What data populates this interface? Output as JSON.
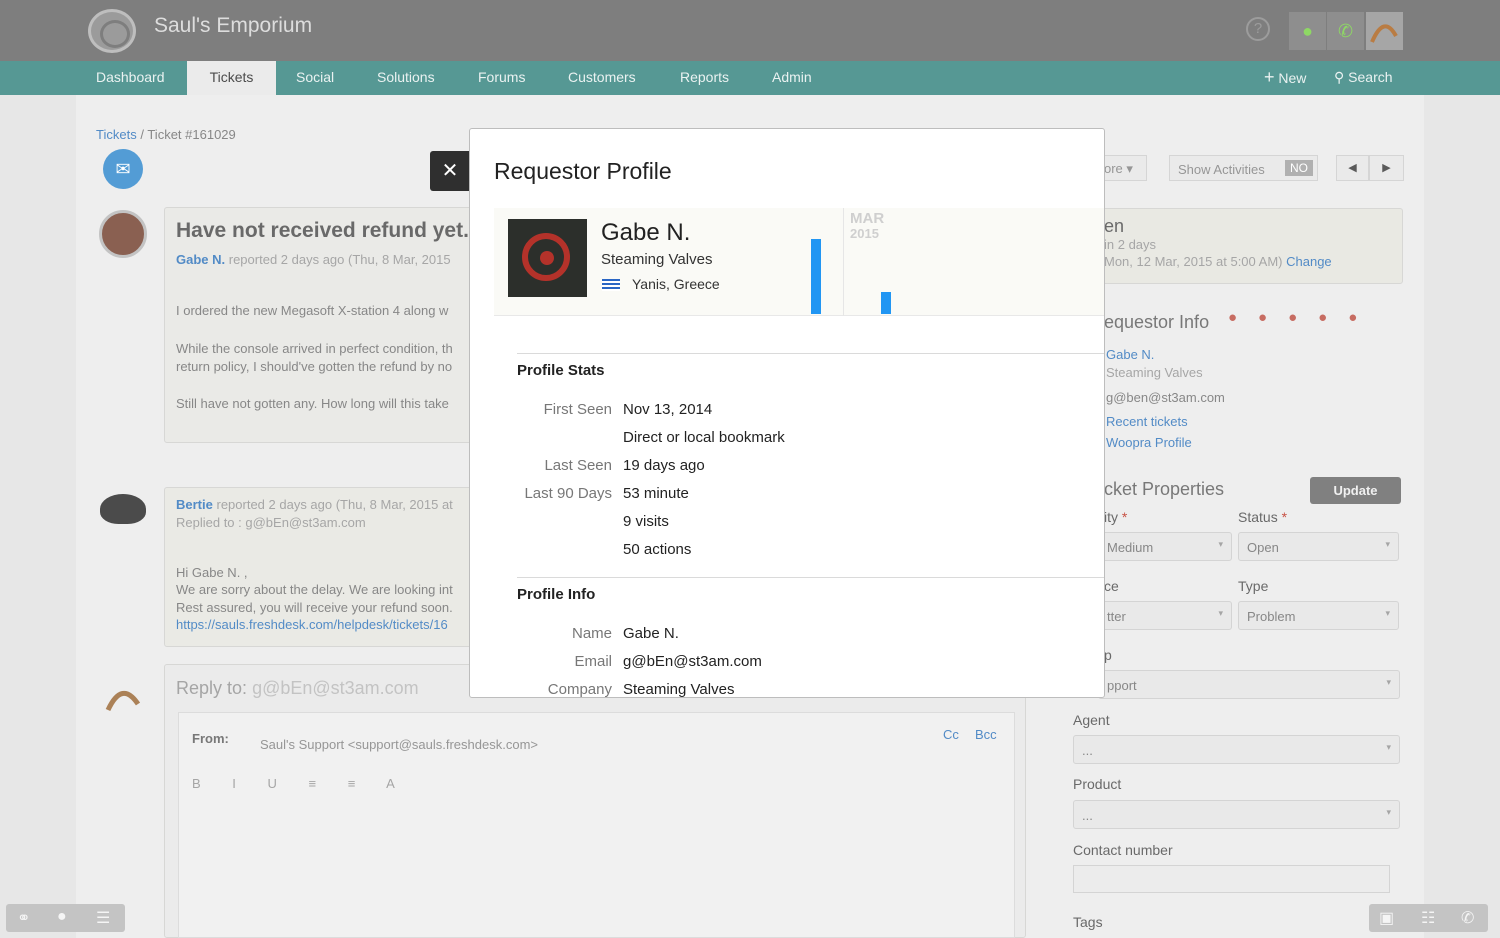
{
  "app": {
    "brand": "Saul's Emporium"
  },
  "nav": {
    "items": [
      "Dashboard",
      "Tickets",
      "Social",
      "Solutions",
      "Forums",
      "Customers",
      "Reports",
      "Admin"
    ],
    "active": "Tickets",
    "new_label": "New",
    "search_label": "Search"
  },
  "breadcrumb": {
    "root": "Tickets",
    "sep": "/",
    "current": "Ticket #161029"
  },
  "ticket": {
    "subject": "Have not received refund yet.",
    "requester": "Gabe N.",
    "reported": "reported 2 days ago (Thu, 8 Mar, 2015",
    "body1": "I ordered the new Megasoft X-station 4 along w",
    "body2a": "While the console arrived in perfect condition, th",
    "body2b": "return policy, I should've gotten the refund by no",
    "body3": "Still have not gotten any. How long will this take"
  },
  "reply": {
    "author": "Bertie",
    "meta": "reported 2 days ago (Thu, 8 Mar, 2015 at",
    "replied_to": "Replied to : g@bEn@st3am.com",
    "l1": "Hi Gabe N. ,",
    "l2": "We are sorry about the delay. We are looking int",
    "l3": "Rest assured, you will receive your refund soon.",
    "link": "https://sauls.freshdesk.com/helpdesk/tickets/16"
  },
  "composer": {
    "reply_to_label": "Reply to:",
    "reply_to_email": "g@bEn@st3am.com",
    "from_label": "From:",
    "from_value": "Saul's Support <support@sauls.freshdesk.com>",
    "cc": "Cc",
    "bcc": "Bcc"
  },
  "toolbar": {
    "more": "ore",
    "show_activities": "Show Activities",
    "toggle": "NO"
  },
  "side": {
    "status_title": "en",
    "due_line1": "in 2 days",
    "due_line2": "Mon, 12 Mar, 2015 at 5:00 AM)",
    "change": "Change",
    "requestor_title": "equestor Info",
    "req_name": "Gabe N.",
    "req_company": "Steaming Valves",
    "req_email": "g@ben@st3am.com",
    "recent_tickets": "Recent tickets",
    "woopra_profile": "Woopra Profile",
    "props_title": "cket Properties",
    "update": "Update",
    "priority_label": "ity",
    "status_label": "Status",
    "priority_value": "Medium",
    "status_value": "Open",
    "source_label": "ce",
    "type_label": "Type",
    "source_value": "tter",
    "type_value": "Problem",
    "group_label": "p",
    "group_value": "pport",
    "agent_label": "Agent",
    "agent_value": "...",
    "product_label": "Product",
    "product_value": "...",
    "contact_label": "Contact number",
    "tags_label": "Tags"
  },
  "modal": {
    "title": "Requestor Profile",
    "name": "Gabe N.",
    "company": "Steaming Valves",
    "location": "Yanis, Greece",
    "month": "MAR",
    "year": "2015",
    "stats_title": "Profile Stats",
    "first_seen_label": "First Seen",
    "first_seen": "Nov 13, 2014",
    "first_seen_src": "Direct or local bookmark",
    "last_seen_label": "Last Seen",
    "last_seen": "19 days ago",
    "last90_label": "Last 90 Days",
    "last90_minutes": "53 minute",
    "last90_visits": "9 visits",
    "last90_actions": "50 actions",
    "info_title": "Profile Info",
    "name_label": "Name",
    "email_label": "Email",
    "email": "g@bEn@st3am.com",
    "company_label": "Company"
  },
  "chart_data": {
    "type": "bar",
    "title": "",
    "categories": [
      "",
      ""
    ],
    "values": [
      0.75,
      0.22
    ]
  },
  "colors": {
    "accent": "#3f8a86",
    "bar": "#2196f3",
    "link": "#3b7bbf"
  }
}
